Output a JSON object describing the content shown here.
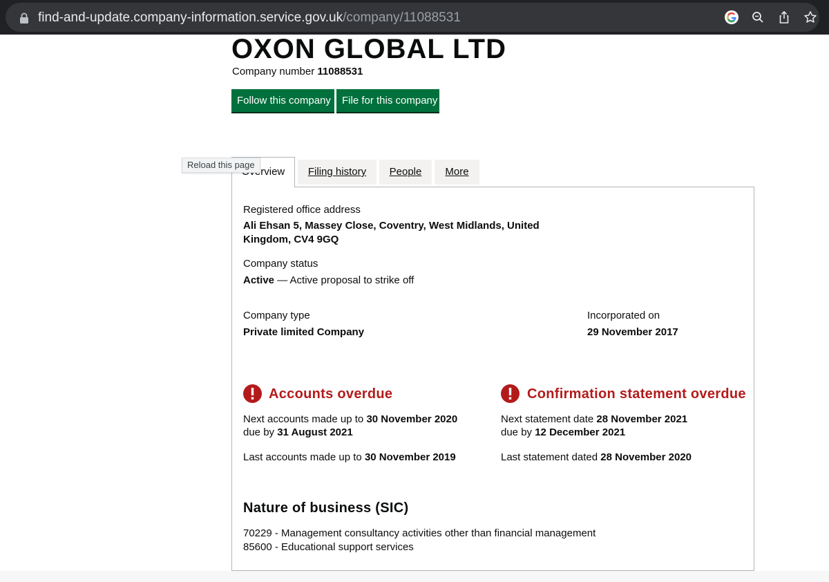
{
  "browser": {
    "url_domain": "find-and-update.company-information.service.gov.uk",
    "url_path": "/company/11088531",
    "icons": [
      "lock-icon",
      "google-icon",
      "zoom-icon",
      "share-icon",
      "star-icon"
    ]
  },
  "tooltip": "Reload this page",
  "company": {
    "name": "OXON GLOBAL LTD",
    "number_label": "Company number",
    "number": "11088531"
  },
  "actions": {
    "follow": "Follow this company",
    "file": "File for this company"
  },
  "tabs": [
    {
      "label": "Overview",
      "active": true
    },
    {
      "label": "Filing history",
      "active": false
    },
    {
      "label": "People",
      "active": false
    },
    {
      "label": "More",
      "active": false
    }
  ],
  "overview": {
    "address_label": "Registered office address",
    "address_line1": "Ali Ehsan 5, Massey Close, Coventry, West Midlands, United",
    "address_line2": "Kingdom, CV4 9GQ",
    "status_label": "Company status",
    "status_value": "Active",
    "status_note": " — Active proposal to strike off",
    "type_label": "Company type",
    "type_value": "Private limited Company",
    "incorporated_label": "Incorporated on",
    "incorporated_value": "29 November 2017"
  },
  "accounts": {
    "heading": "Accounts overdue",
    "next_prefix": "Next accounts made up to ",
    "next_date": "30 November 2020",
    "due_prefix": "due by ",
    "due_date": "31 August 2021",
    "last_prefix": "Last accounts made up to ",
    "last_date": "30 November 2019"
  },
  "confirmation": {
    "heading": "Confirmation statement overdue",
    "next_prefix": "Next statement date ",
    "next_date": "28 November 2021",
    "due_prefix": "due by ",
    "due_date": "12 December 2021",
    "last_prefix": "Last statement dated ",
    "last_date": "28 November 2020"
  },
  "sic": {
    "heading": "Nature of business (SIC)",
    "items": [
      "70229 - Management consultancy activities other than financial management",
      "85600 - Educational support services"
    ]
  },
  "colors": {
    "button_green": "#00703c",
    "warning_red": "#b31b1b",
    "browser_bar": "#202124"
  }
}
